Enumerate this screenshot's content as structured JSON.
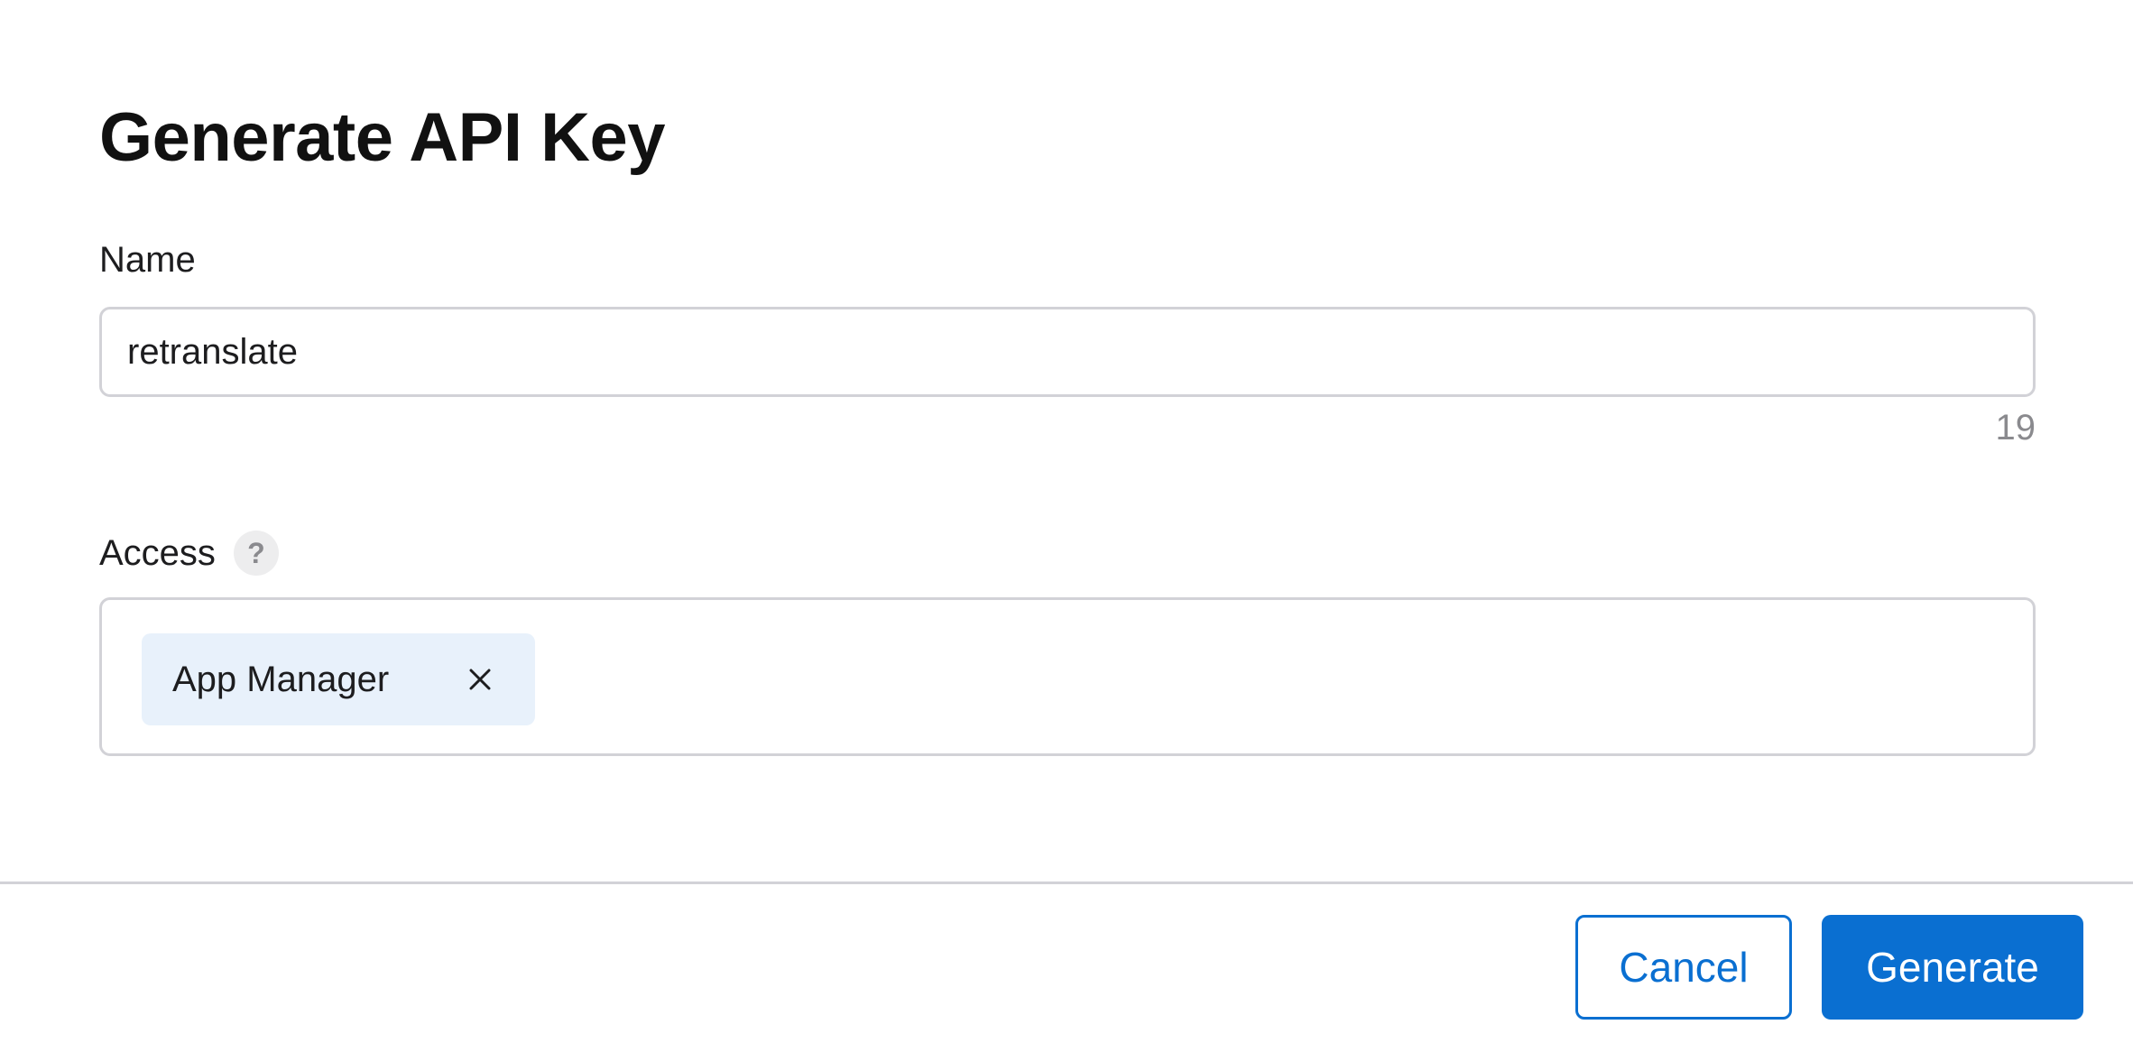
{
  "dialog": {
    "title": "Generate API Key",
    "name_field": {
      "label": "Name",
      "value": "retranslate",
      "char_count": "19"
    },
    "access_field": {
      "label": "Access",
      "help_icon": "question-mark-icon",
      "selected_roles": [
        "App Manager"
      ],
      "remove_icon": "close-icon"
    },
    "buttons": {
      "cancel_label": "Cancel",
      "generate_label": "Generate"
    }
  },
  "colors": {
    "accent": "#0a6fd1",
    "chip_background": "#e8f1fb",
    "border": "#d2d2d7",
    "muted_text": "#8a8a8e"
  }
}
